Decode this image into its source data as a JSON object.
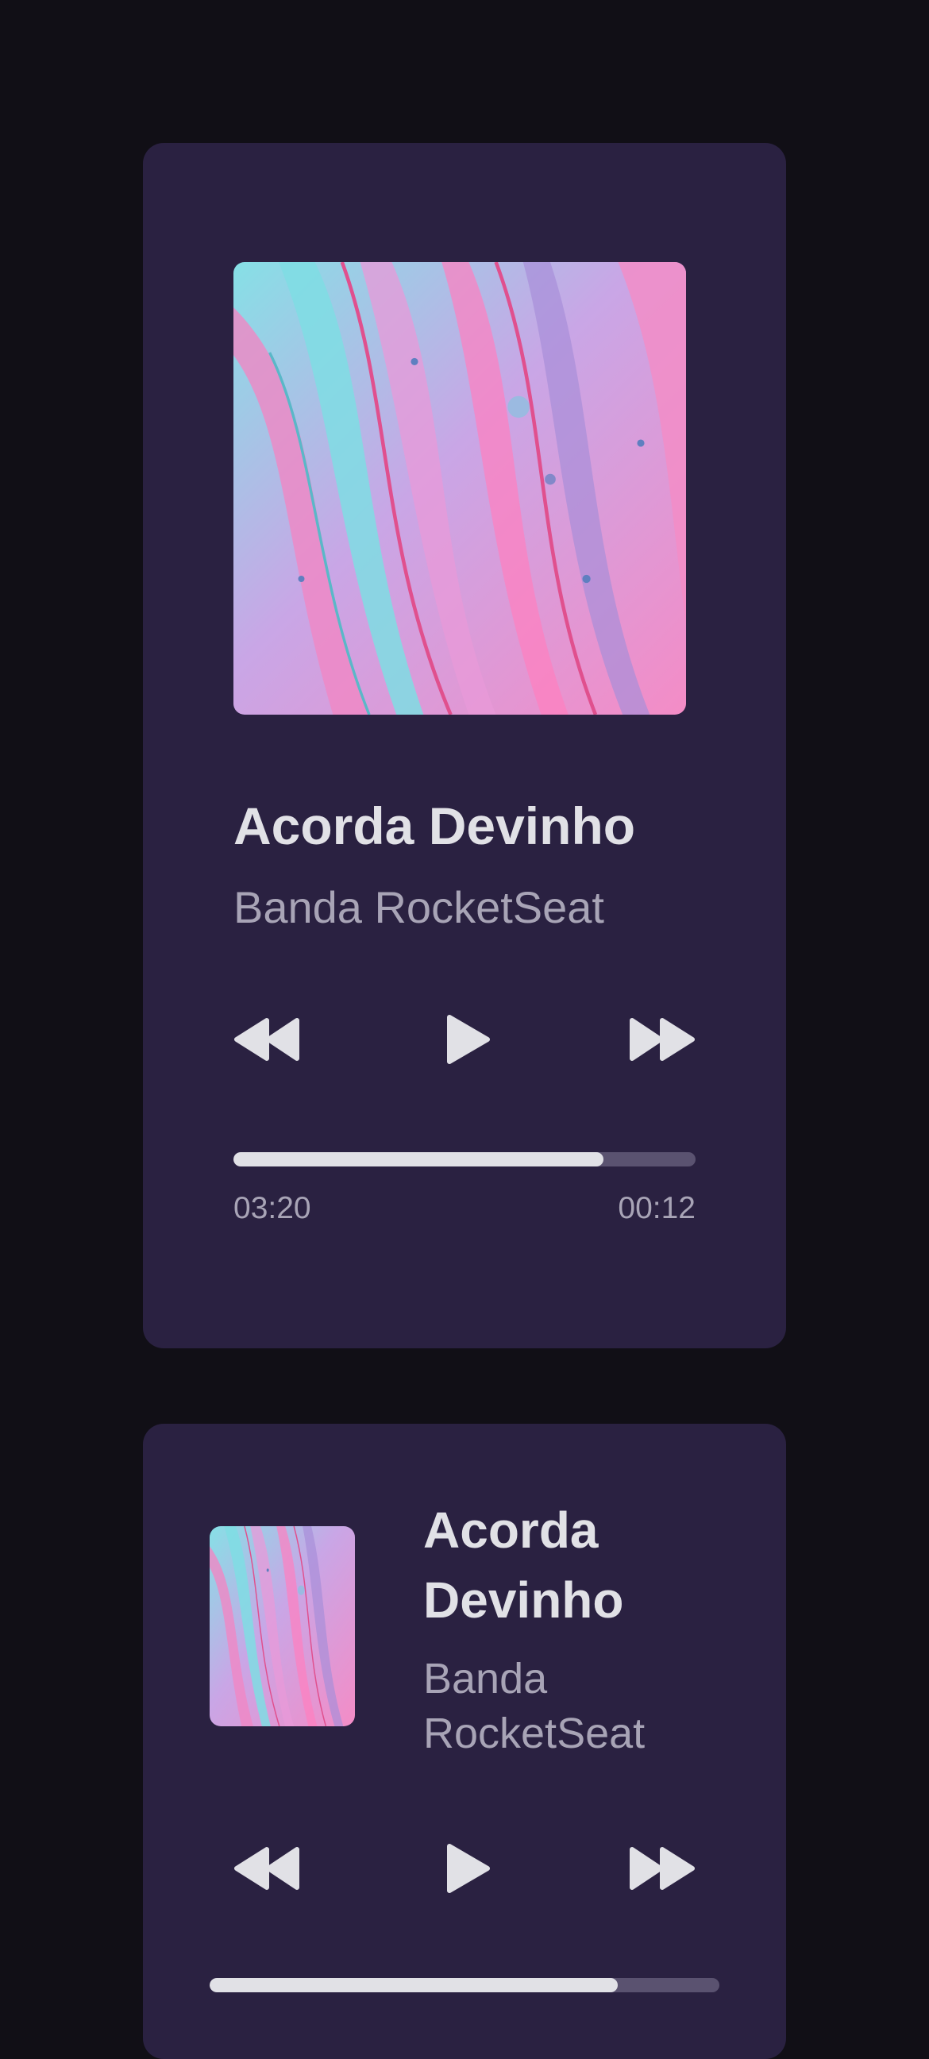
{
  "players": [
    {
      "title": "Acorda Devinho",
      "artist": "Banda RocketSeat",
      "progress_fraction": 0.8,
      "time_elapsed": "03:20",
      "time_remaining": "00:12"
    },
    {
      "title": "Acorda Devinho",
      "artist": "Banda RocketSeat",
      "progress_fraction": 0.8
    }
  ],
  "icons": {
    "prev": "rewind-icon",
    "play": "play-icon",
    "next": "fast-forward-icon"
  },
  "colors": {
    "background": "#110F16",
    "card": "#2A2141",
    "title": "#E1E1E6",
    "subtitle": "#A8A4B6",
    "track": "#5A5270",
    "fill": "#E1E1E6"
  }
}
